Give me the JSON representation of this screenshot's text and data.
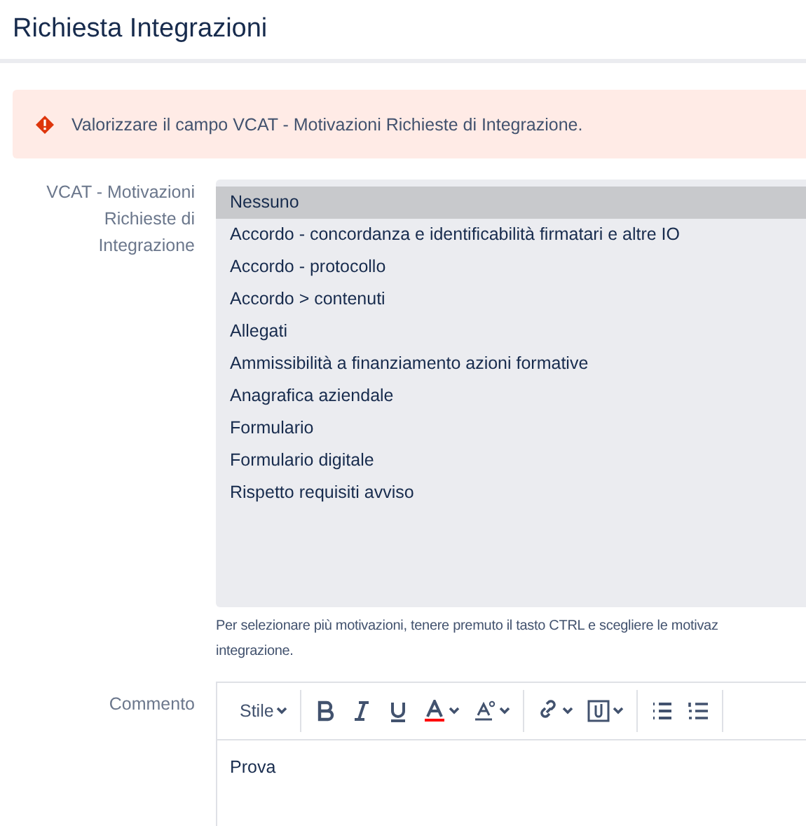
{
  "header": {
    "title": "Richiesta Integrazioni"
  },
  "alert": {
    "message": "Valorizzare il campo VCAT - Motivazioni Richieste di Integrazione."
  },
  "motivations": {
    "label": "VCAT - Motivazioni Richieste di Integrazione",
    "options": [
      {
        "label": "Nessuno",
        "selected": true
      },
      {
        "label": "Accordo - concordanza e identificabilità firmatari e altre IO",
        "selected": false
      },
      {
        "label": "Accordo - protocollo",
        "selected": false
      },
      {
        "label": "Accordo > contenuti",
        "selected": false
      },
      {
        "label": "Allegati",
        "selected": false
      },
      {
        "label": "Ammissibilità a finanziamento azioni formative",
        "selected": false
      },
      {
        "label": "Anagrafica aziendale",
        "selected": false
      },
      {
        "label": "Formulario",
        "selected": false
      },
      {
        "label": "Formulario digitale",
        "selected": false
      },
      {
        "label": "Rispetto requisiti avviso",
        "selected": false
      }
    ],
    "help_lines": [
      "Per selezionare più motivazioni, tenere premuto il tasto CTRL e scegliere le motivaz",
      "integrazione."
    ]
  },
  "comment": {
    "label": "Commento",
    "style_menu": "Stile",
    "value": "Prova"
  }
}
